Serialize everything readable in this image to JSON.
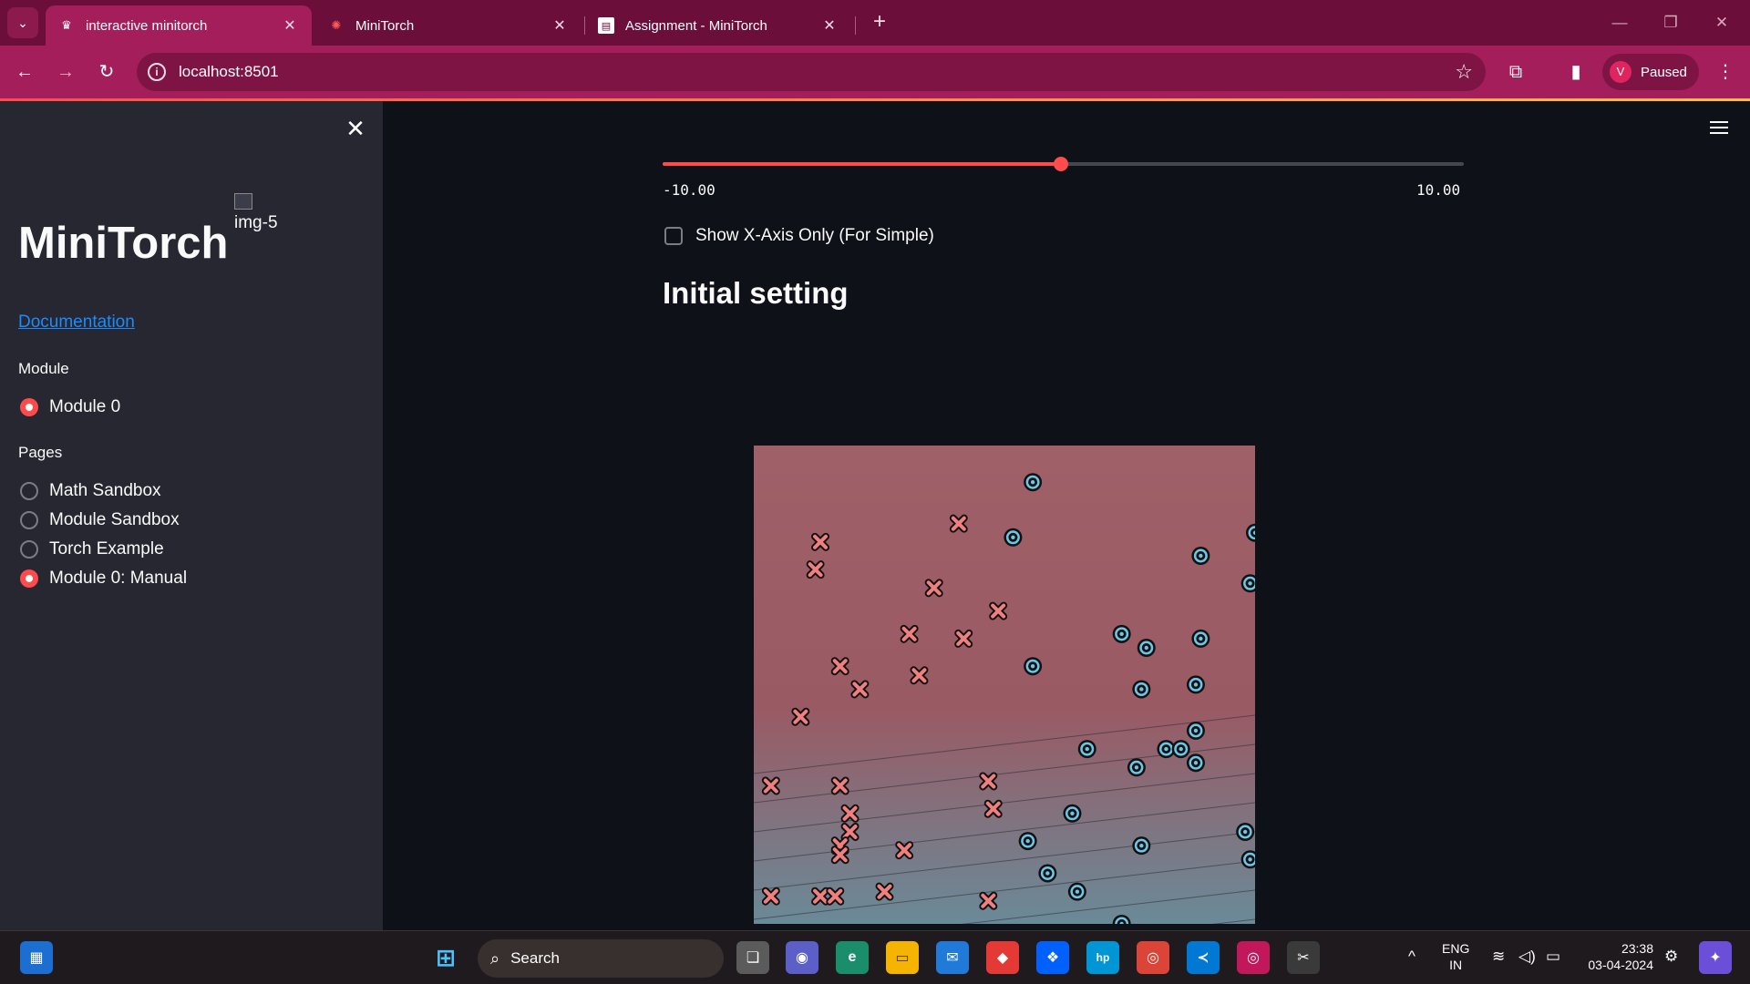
{
  "browser": {
    "tabs": [
      {
        "title": "interactive minitorch",
        "favicon": "crown-icon",
        "active": true
      },
      {
        "title": "MiniTorch",
        "favicon": "torch-icon",
        "active": false
      },
      {
        "title": "Assignment - MiniTorch",
        "favicon": "document-icon",
        "active": false
      }
    ],
    "url": "localhost:8501",
    "profile_initial": "V",
    "profile_status": "Paused",
    "theme_color": "#a51e5c"
  },
  "sidebar": {
    "title": "MiniTorch",
    "image_alt": "img-5",
    "doc_link": "Documentation",
    "module_label": "Module",
    "modules": [
      {
        "label": "Module 0",
        "selected": true
      }
    ],
    "pages_label": "Pages",
    "pages": [
      {
        "label": "Math Sandbox",
        "selected": false
      },
      {
        "label": "Module Sandbox",
        "selected": false
      },
      {
        "label": "Torch Example",
        "selected": false
      },
      {
        "label": "Module 0: Manual",
        "selected": true
      }
    ]
  },
  "main": {
    "slider": {
      "min_label": "-10.00",
      "max_label": "10.00",
      "min": -10,
      "max": 10,
      "value": -0.05
    },
    "checkbox_label": "Show X-Axis Only (For Simple)",
    "checkbox_checked": false,
    "section_title": "Initial setting",
    "accent": "#ff4b4b"
  },
  "chart_data": {
    "type": "scatter",
    "series": [
      {
        "marker": "x",
        "color": "#f08080",
        "points": [
          [
            0.4,
            0.87
          ],
          [
            0.12,
            0.83
          ],
          [
            0.11,
            0.77
          ],
          [
            0.35,
            0.73
          ],
          [
            0.48,
            0.68
          ],
          [
            0.3,
            0.63
          ],
          [
            0.41,
            0.62
          ],
          [
            0.16,
            0.56
          ],
          [
            0.2,
            0.51
          ],
          [
            0.32,
            0.54
          ],
          [
            0.08,
            0.45
          ],
          [
            0.02,
            0.3
          ],
          [
            0.16,
            0.3
          ],
          [
            0.18,
            0.24
          ],
          [
            0.18,
            0.2
          ],
          [
            0.16,
            0.17
          ],
          [
            0.16,
            0.15
          ],
          [
            0.29,
            0.16
          ],
          [
            0.46,
            0.31
          ],
          [
            0.47,
            0.25
          ],
          [
            0.02,
            0.06
          ],
          [
            0.12,
            0.06
          ],
          [
            0.15,
            0.06
          ],
          [
            0.25,
            0.07
          ],
          [
            0.46,
            0.05
          ]
        ]
      },
      {
        "marker": "o",
        "color": "#6ec6e6",
        "points": [
          [
            0.55,
            0.96
          ],
          [
            0.51,
            0.84
          ],
          [
            1.0,
            0.85
          ],
          [
            0.89,
            0.8
          ],
          [
            0.99,
            0.74
          ],
          [
            0.73,
            0.63
          ],
          [
            0.78,
            0.6
          ],
          [
            0.89,
            0.62
          ],
          [
            0.55,
            0.56
          ],
          [
            0.77,
            0.51
          ],
          [
            0.88,
            0.52
          ],
          [
            0.66,
            0.38
          ],
          [
            0.82,
            0.38
          ],
          [
            0.85,
            0.38
          ],
          [
            0.88,
            0.42
          ],
          [
            0.76,
            0.34
          ],
          [
            0.88,
            0.35
          ],
          [
            0.63,
            0.24
          ],
          [
            0.54,
            0.18
          ],
          [
            0.77,
            0.17
          ],
          [
            0.98,
            0.2
          ],
          [
            0.58,
            0.11
          ],
          [
            0.64,
            0.07
          ],
          [
            0.99,
            0.14
          ],
          [
            0.73,
            0.0
          ]
        ]
      }
    ],
    "background": {
      "top_color": "#a06068",
      "bottom_color": "#6a8a98"
    }
  },
  "taskbar": {
    "search_label": "Search",
    "language": "ENG",
    "region": "IN",
    "time": "23:38",
    "date": "03-04-2024"
  }
}
